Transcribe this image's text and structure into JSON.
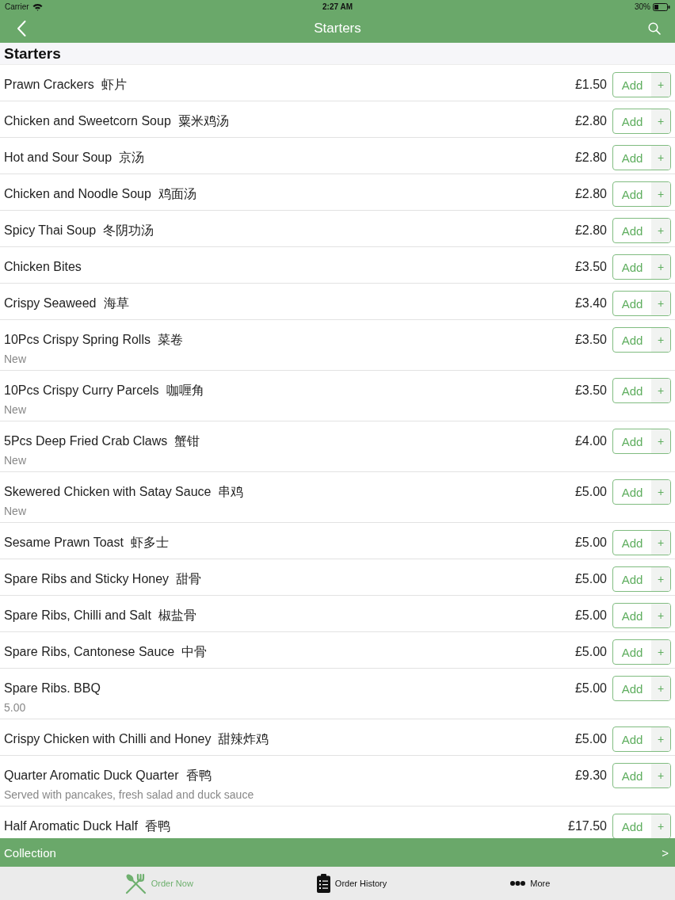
{
  "status_bar": {
    "carrier": "Carrier",
    "time": "2:27 AM",
    "battery": "30%"
  },
  "nav_bar": {
    "title": "Starters"
  },
  "section": {
    "title": "Starters"
  },
  "items": [
    {
      "name": "Prawn Crackers",
      "name_zh": "虾片",
      "price": "£1.50",
      "button": "Add",
      "stepper": "+"
    },
    {
      "name": "Chicken and Sweetcorn Soup",
      "name_zh": "粟米鸡汤",
      "price": "£2.80",
      "button": "Add",
      "stepper": "+"
    },
    {
      "name": "Hot and Sour Soup",
      "name_zh": "京汤",
      "price": "£2.80",
      "button": "Add",
      "stepper": "+"
    },
    {
      "name": "Chicken and Noodle Soup",
      "name_zh": "鸡面汤",
      "price": "£2.80",
      "button": "Add",
      "stepper": "+"
    },
    {
      "name": "Spicy Thai Soup",
      "name_zh": "冬阴功汤",
      "price": "£2.80",
      "button": "Add",
      "stepper": "+"
    },
    {
      "name": "Chicken Bites",
      "price": "£3.50",
      "button": "Add",
      "stepper": "+"
    },
    {
      "name": "Crispy Seaweed",
      "name_zh": "海草",
      "price": "£3.40",
      "button": "Add",
      "stepper": "+"
    },
    {
      "name": "10Pcs Crispy Spring Rolls",
      "name_zh": "菜卷",
      "note": "New",
      "price": "£3.50",
      "button": "Add",
      "stepper": "+"
    },
    {
      "name": "10Pcs Crispy Curry Parcels",
      "name_zh": "咖喱角",
      "note": "New",
      "price": "£3.50",
      "button": "Add",
      "stepper": "+"
    },
    {
      "name": "5Pcs Deep Fried Crab Claws",
      "name_zh": "蟹钳",
      "note": "New",
      "price": "£4.00",
      "button": "Add",
      "stepper": "+"
    },
    {
      "name": "Skewered Chicken with Satay Sauce",
      "name_zh": "串鸡",
      "note": "New",
      "price": "£5.00",
      "button": "Add",
      "stepper": "+"
    },
    {
      "name": "Sesame Prawn Toast",
      "name_zh": "虾多士",
      "price": "£5.00",
      "button": "Add",
      "stepper": "+"
    },
    {
      "name": "Spare Ribs and Sticky Honey",
      "name_zh": "甜骨",
      "price": "£5.00",
      "button": "Add",
      "stepper": "+"
    },
    {
      "name": "Spare Ribs, Chilli and Salt",
      "name_zh": "椒盐骨",
      "price": "£5.00",
      "button": "Add",
      "stepper": "+"
    },
    {
      "name": "Spare Ribs, Cantonese Sauce",
      "name_zh": "中骨",
      "price": "£5.00",
      "button": "Add",
      "stepper": "+"
    },
    {
      "name": "Spare Ribs. BBQ",
      "note": "5.00",
      "price": "£5.00",
      "button": "Add",
      "stepper": "+"
    },
    {
      "name": "Crispy Chicken with Chilli and Honey",
      "name_zh": "甜辣炸鸡",
      "price": "£5.00",
      "button": "Add",
      "stepper": "+"
    },
    {
      "name": "Quarter Aromatic Duck Quarter",
      "name_zh": "香鸭",
      "note": "Served with pancakes, fresh salad and duck sauce",
      "price": "£9.30",
      "button": "Add",
      "stepper": "+"
    },
    {
      "name": "Half Aromatic Duck Half",
      "name_zh": "香鸭",
      "price": "£17.50",
      "button": "Add",
      "stepper": "+"
    }
  ],
  "collection_bar": {
    "label": "Collection",
    "chevron": ">"
  },
  "tab_bar": [
    {
      "label": "Order Now",
      "selected": true
    },
    {
      "label": "Order History",
      "selected": false
    },
    {
      "label": "More",
      "selected": false
    }
  ]
}
